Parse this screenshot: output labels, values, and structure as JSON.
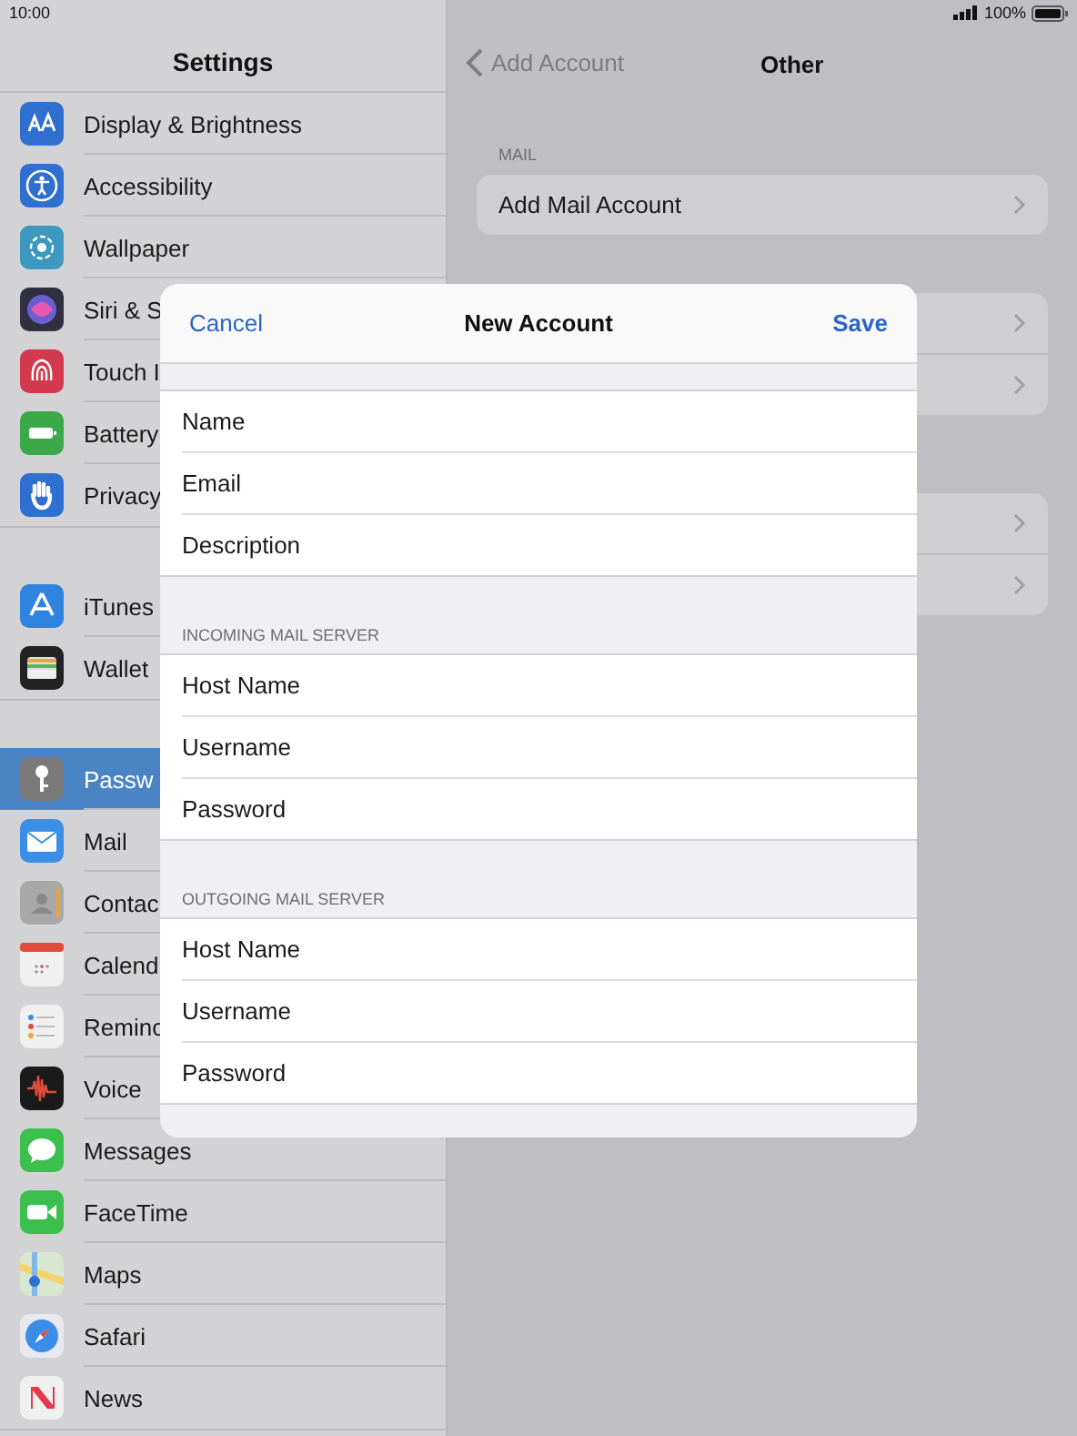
{
  "status_bar": {
    "time": "10:00",
    "battery": "100%"
  },
  "sidebar": {
    "title": "Settings",
    "groups": [
      [
        {
          "label": "Display & Brightness",
          "selected": false
        },
        {
          "label": "Accessibility",
          "selected": false
        },
        {
          "label": "Wallpaper",
          "selected": false
        },
        {
          "label": "Siri & S",
          "selected": false
        },
        {
          "label": "Touch I",
          "selected": false
        },
        {
          "label": "Battery",
          "selected": false
        },
        {
          "label": "Privacy",
          "selected": false
        }
      ],
      [
        {
          "label": "iTunes",
          "selected": false
        },
        {
          "label": "Wallet",
          "selected": false
        }
      ],
      [
        {
          "label": "Passw",
          "selected": true
        },
        {
          "label": "Mail",
          "selected": false
        },
        {
          "label": "Contac",
          "selected": false
        },
        {
          "label": "Calend",
          "selected": false
        },
        {
          "label": "Reminc",
          "selected": false
        },
        {
          "label": "Voice",
          "selected": false
        },
        {
          "label": "Messages",
          "selected": false
        },
        {
          "label": "FaceTime",
          "selected": false
        },
        {
          "label": "Maps",
          "selected": false
        },
        {
          "label": "Safari",
          "selected": false
        },
        {
          "label": "News",
          "selected": false
        }
      ]
    ]
  },
  "detail": {
    "back": "Add Account",
    "title": "Other",
    "section": "MAIL",
    "rows": [
      "Add Mail Account"
    ]
  },
  "modal": {
    "cancel": "Cancel",
    "title": "New Account",
    "save": "Save",
    "sections": [
      {
        "fields": [
          "Name",
          "Email",
          "Description"
        ]
      },
      {
        "header": "INCOMING MAIL SERVER",
        "fields": [
          "Host Name",
          "Username",
          "Password"
        ]
      },
      {
        "header": "OUTGOING MAIL SERVER",
        "fields": [
          "Host Name",
          "Username",
          "Password"
        ]
      }
    ]
  }
}
